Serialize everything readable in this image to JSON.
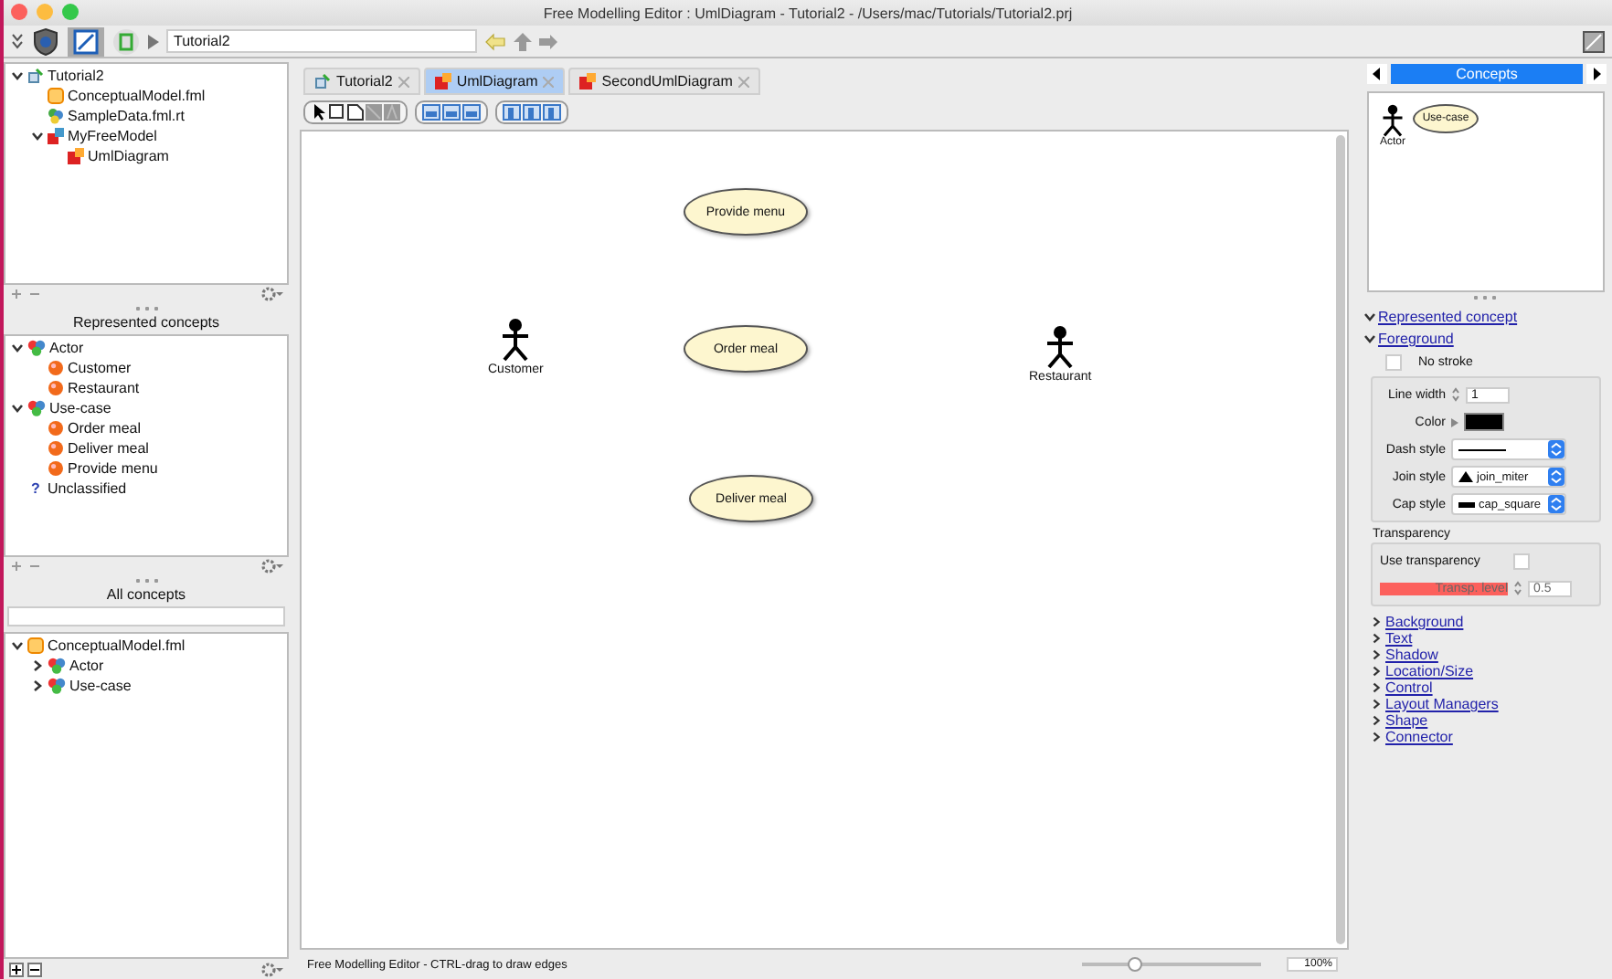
{
  "window": {
    "title": "Free Modelling Editor : UmlDiagram - Tutorial2 - /Users/mac/Tutorials/Tutorial2.prj"
  },
  "toolbar": {
    "path": "Tutorial2"
  },
  "project_tree": [
    {
      "label": "Tutorial2",
      "kind": "project",
      "expanded": true,
      "children": [
        {
          "label": "ConceptualModel.fml",
          "kind": "fml"
        },
        {
          "label": "SampleData.fml.rt",
          "kind": "data"
        },
        {
          "label": "MyFreeModel",
          "kind": "model",
          "expanded": true,
          "children": [
            {
              "label": "UmlDiagram",
              "kind": "diagram"
            }
          ]
        }
      ]
    }
  ],
  "represented_concepts": {
    "title": "Represented concepts",
    "tree": [
      {
        "label": "Actor",
        "kind": "concept",
        "expanded": true,
        "children": [
          {
            "label": "Customer",
            "kind": "instance"
          },
          {
            "label": "Restaurant",
            "kind": "instance"
          }
        ]
      },
      {
        "label": "Use-case",
        "kind": "concept",
        "expanded": true,
        "children": [
          {
            "label": "Order meal",
            "kind": "instance"
          },
          {
            "label": "Deliver meal",
            "kind": "instance"
          },
          {
            "label": "Provide menu",
            "kind": "instance"
          }
        ]
      },
      {
        "label": "Unclassified",
        "kind": "unknown",
        "glyph": "?"
      }
    ]
  },
  "all_concepts": {
    "title": "All concepts",
    "tree": [
      {
        "label": "ConceptualModel.fml",
        "kind": "fml",
        "expanded": true,
        "children": [
          {
            "label": "Actor",
            "kind": "concept",
            "expanded": false
          },
          {
            "label": "Use-case",
            "kind": "concept",
            "expanded": false
          }
        ]
      }
    ]
  },
  "tabs": [
    {
      "label": "Tutorial2",
      "kind": "project",
      "selected": false
    },
    {
      "label": "UmlDiagram",
      "kind": "diagram",
      "selected": true
    },
    {
      "label": "SecondUmlDiagram",
      "kind": "diagram",
      "selected": false
    }
  ],
  "diagram": {
    "nodes": [
      {
        "kind": "usecase",
        "label": "Provide menu"
      },
      {
        "kind": "actor",
        "label": "Customer"
      },
      {
        "kind": "usecase",
        "label": "Order meal"
      },
      {
        "kind": "actor",
        "label": "Restaurant"
      },
      {
        "kind": "usecase",
        "label": "Deliver meal"
      }
    ]
  },
  "status_bar": {
    "message": "Free Modelling Editor - CTRL-drag to draw edges",
    "zoom": "100%",
    "level": 0.3
  },
  "palette": {
    "title": "Concepts",
    "items": [
      {
        "kind": "actor",
        "label": "Actor"
      },
      {
        "kind": "usecase",
        "label": "Use-case"
      }
    ]
  },
  "inspector": {
    "sections": [
      {
        "label": "Represented concept",
        "expanded": true
      },
      {
        "label": "Foreground",
        "expanded": true
      }
    ],
    "no_stroke": {
      "label": "No stroke",
      "checked": false
    },
    "line_width": {
      "label": "Line width",
      "value": "1"
    },
    "color": {
      "label": "Color",
      "color": "#000000"
    },
    "dash_style": {
      "label": "Dash style"
    },
    "join_style": {
      "label": "Join style",
      "value": "join_miter"
    },
    "cap_style": {
      "label": "Cap style",
      "value": "cap_square"
    },
    "transparency": {
      "title": "Transparency",
      "use_label": "Use transparency",
      "checked": false,
      "level_label": "Transp. level",
      "level_value": "0.5",
      "disabled": true
    },
    "collapsed_sections": [
      {
        "label": "Background",
        "expanded": false
      },
      {
        "label": "Text",
        "expanded": false
      },
      {
        "label": "Shadow",
        "expanded": false
      },
      {
        "label": "Location/Size",
        "expanded": false
      },
      {
        "label": "Control",
        "expanded": false
      },
      {
        "label": "Layout Managers",
        "expanded": false
      },
      {
        "label": "Shape",
        "expanded": false
      },
      {
        "label": "Connector",
        "expanded": false
      }
    ]
  }
}
